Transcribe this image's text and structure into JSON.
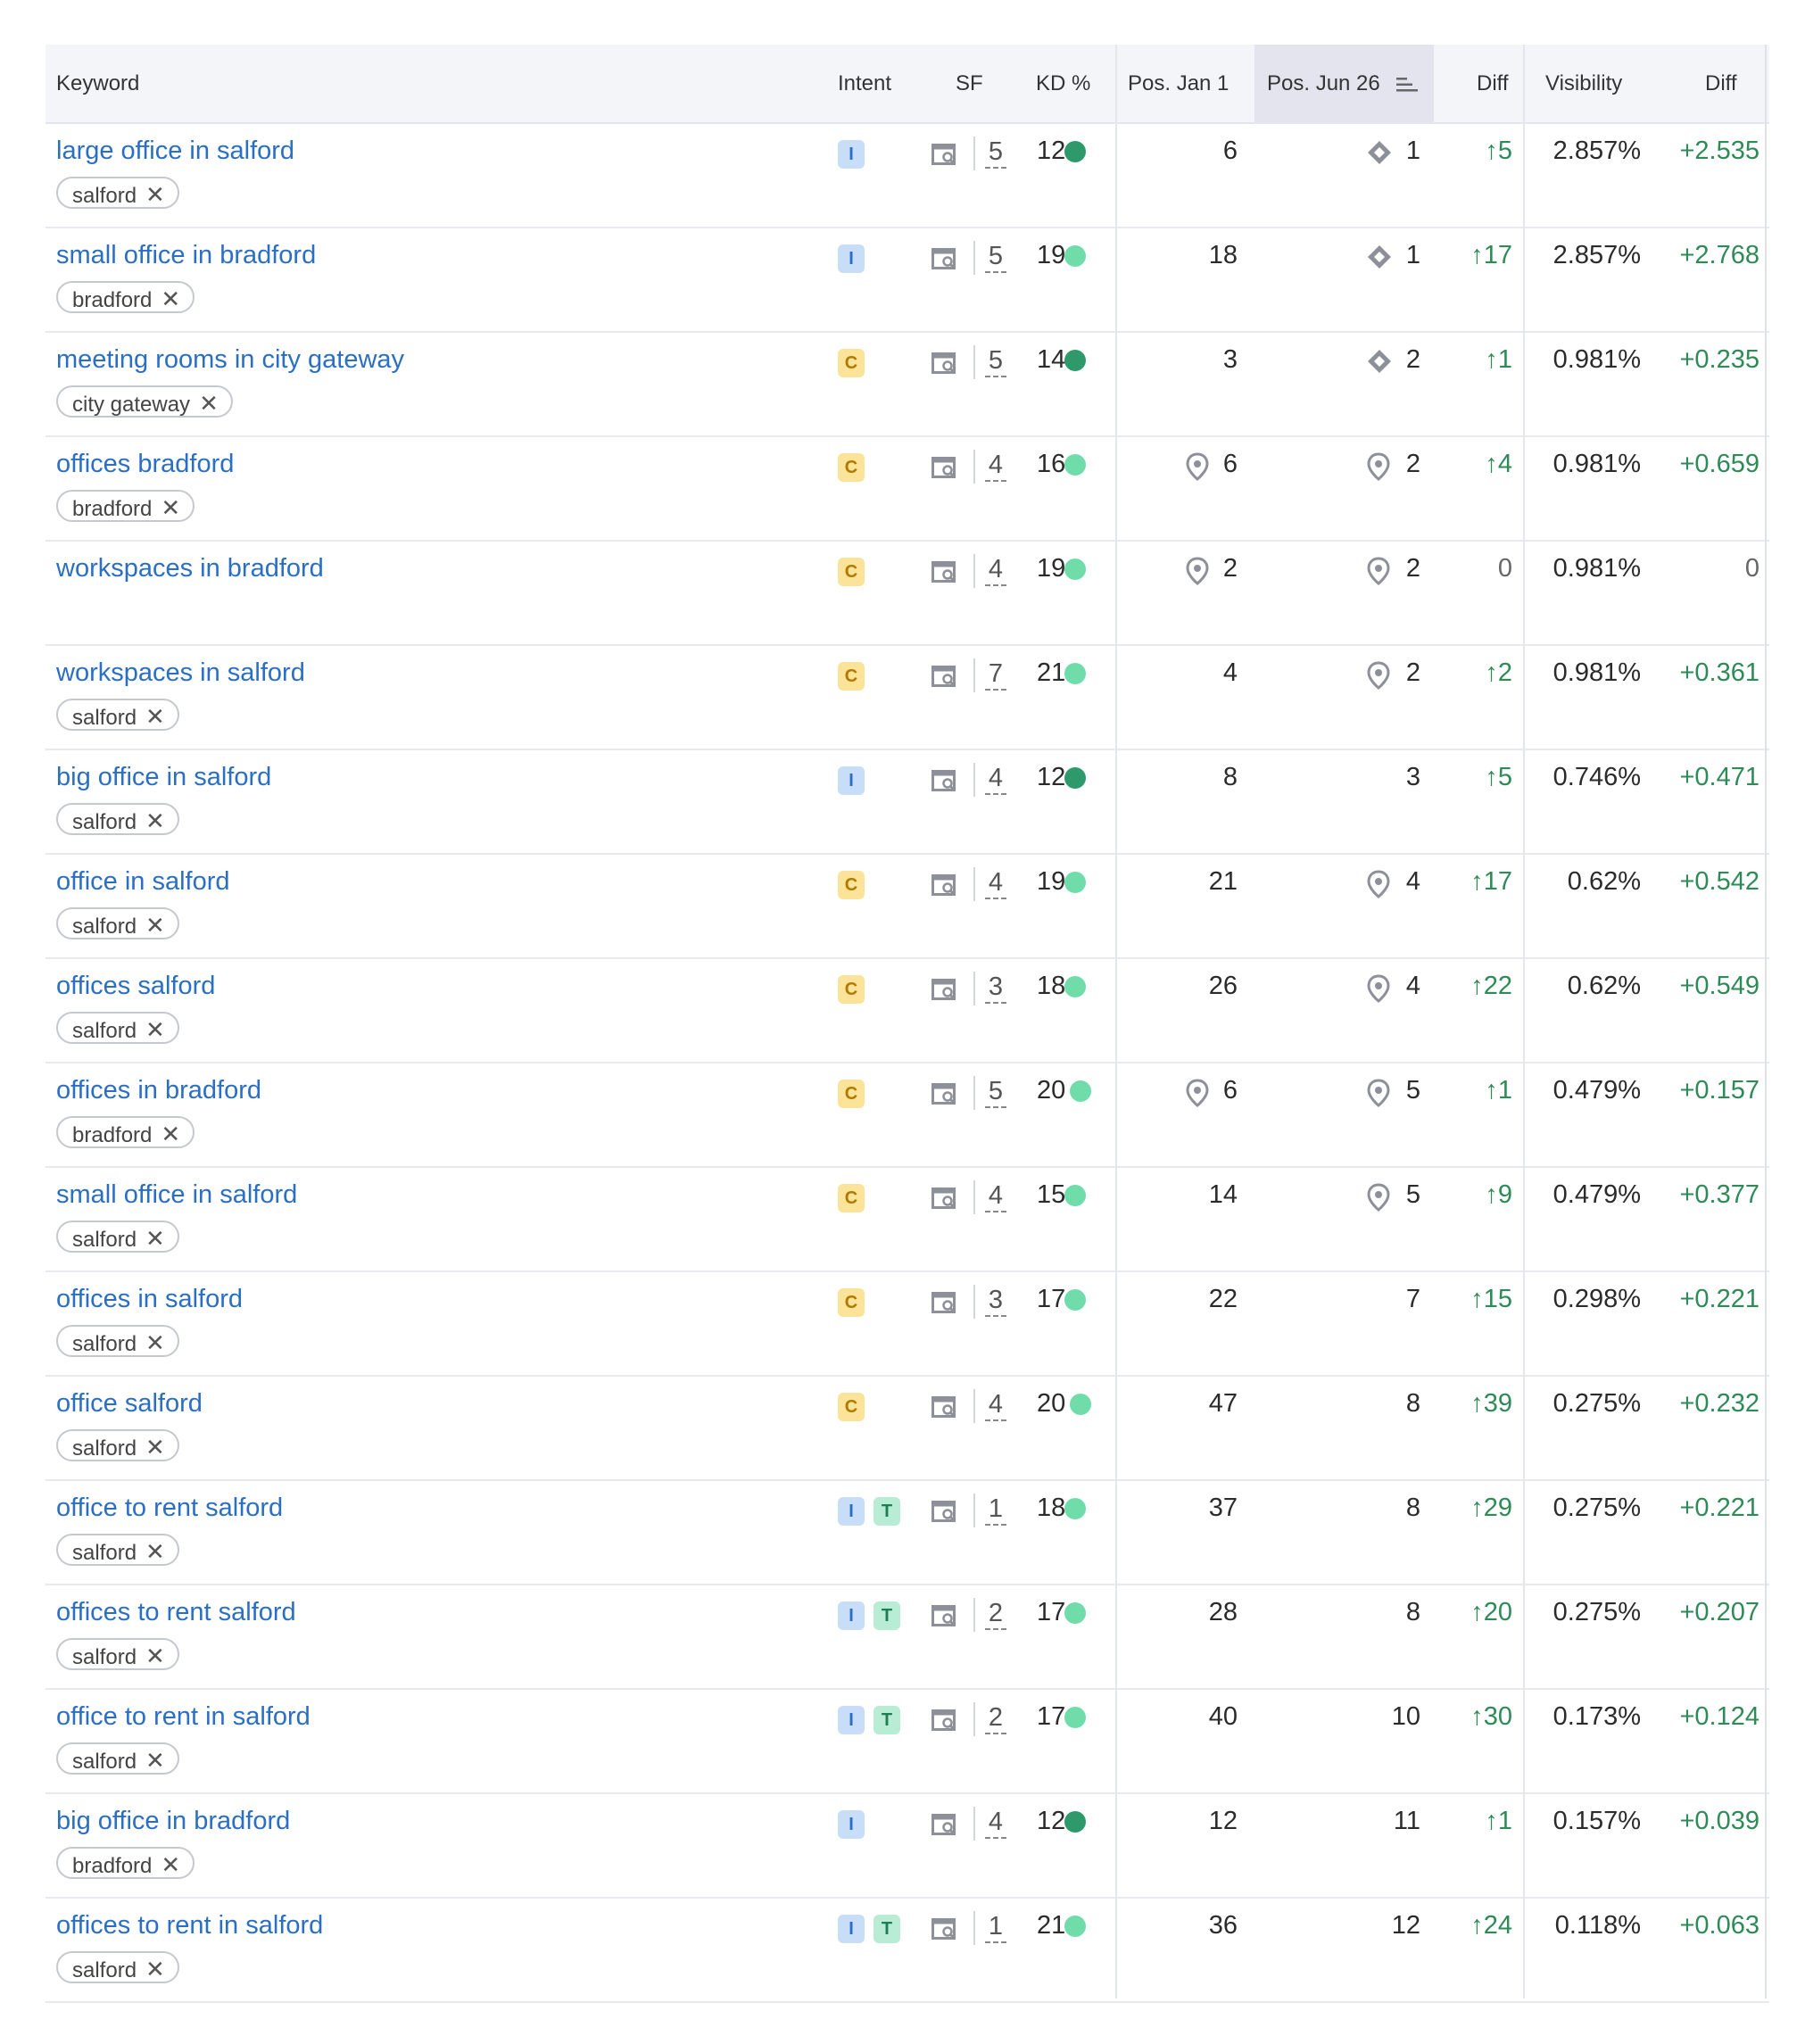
{
  "headers": {
    "keyword": "Keyword",
    "intent": "Intent",
    "sf": "SF",
    "kd": "KD %",
    "pos_jan": "Pos. Jan 1",
    "pos_jun": "Pos. Jun 26",
    "diff": "Diff",
    "visibility": "Visibility",
    "vis_diff": "Diff"
  },
  "colors": {
    "kd_dark": "#2e9a6b",
    "kd_light": "#6fdcaa",
    "link": "#2a6fc4",
    "up": "#2e8b57"
  },
  "rows": [
    {
      "keyword": "large office in salford",
      "tag": "salford",
      "intent": [
        "I"
      ],
      "sf": "5",
      "kd": "12",
      "kd_color": "dark",
      "pos_jan": "6",
      "pos_jan_icon": "",
      "pos_jun": "1",
      "pos_jun_icon": "featured-snippet",
      "diff": "↑5",
      "visibility": "2.857%",
      "vis_diff": "+2.535"
    },
    {
      "keyword": "small office in bradford",
      "tag": "bradford",
      "intent": [
        "I"
      ],
      "sf": "5",
      "kd": "19",
      "kd_color": "light",
      "pos_jan": "18",
      "pos_jan_icon": "",
      "pos_jun": "1",
      "pos_jun_icon": "featured-snippet",
      "diff": "↑17",
      "visibility": "2.857%",
      "vis_diff": "+2.768"
    },
    {
      "keyword": "meeting rooms in city gateway",
      "tag": "city gateway",
      "intent": [
        "C"
      ],
      "sf": "5",
      "kd": "14",
      "kd_color": "dark",
      "pos_jan": "3",
      "pos_jan_icon": "",
      "pos_jun": "2",
      "pos_jun_icon": "featured-snippet",
      "diff": "↑1",
      "visibility": "0.981%",
      "vis_diff": "+0.235"
    },
    {
      "keyword": "offices bradford",
      "tag": "bradford",
      "intent": [
        "C"
      ],
      "sf": "4",
      "kd": "16",
      "kd_color": "light",
      "pos_jan": "6",
      "pos_jan_icon": "local-pack",
      "pos_jun": "2",
      "pos_jun_icon": "local-pack",
      "diff": "↑4",
      "visibility": "0.981%",
      "vis_diff": "+0.659"
    },
    {
      "keyword": "workspaces in bradford",
      "tag": "",
      "intent": [
        "C"
      ],
      "sf": "4",
      "kd": "19",
      "kd_color": "light",
      "pos_jan": "2",
      "pos_jan_icon": "local-pack",
      "pos_jun": "2",
      "pos_jun_icon": "local-pack",
      "diff": "0",
      "visibility": "0.981%",
      "vis_diff": "0"
    },
    {
      "keyword": "workspaces in salford",
      "tag": "salford",
      "intent": [
        "C"
      ],
      "sf": "7",
      "kd": "21",
      "kd_color": "light",
      "pos_jan": "4",
      "pos_jan_icon": "",
      "pos_jun": "2",
      "pos_jun_icon": "local-pack",
      "diff": "↑2",
      "visibility": "0.981%",
      "vis_diff": "+0.361"
    },
    {
      "keyword": "big office in salford",
      "tag": "salford",
      "intent": [
        "I"
      ],
      "sf": "4",
      "kd": "12",
      "kd_color": "dark",
      "pos_jan": "8",
      "pos_jan_icon": "",
      "pos_jun": "3",
      "pos_jun_icon": "",
      "diff": "↑5",
      "visibility": "0.746%",
      "vis_diff": "+0.471"
    },
    {
      "keyword": "office in salford",
      "tag": "salford",
      "intent": [
        "C"
      ],
      "sf": "4",
      "kd": "19",
      "kd_color": "light",
      "pos_jan": "21",
      "pos_jan_icon": "",
      "pos_jun": "4",
      "pos_jun_icon": "local-pack",
      "diff": "↑17",
      "visibility": "0.62%",
      "vis_diff": "+0.542"
    },
    {
      "keyword": "offices salford",
      "tag": "salford",
      "intent": [
        "C"
      ],
      "sf": "3",
      "kd": "18",
      "kd_color": "light",
      "pos_jan": "26",
      "pos_jan_icon": "",
      "pos_jun": "4",
      "pos_jun_icon": "local-pack",
      "diff": "↑22",
      "visibility": "0.62%",
      "vis_diff": "+0.549"
    },
    {
      "keyword": "offices in bradford",
      "tag": "bradford",
      "intent": [
        "C"
      ],
      "sf": "5",
      "kd": "20",
      "kd_color": "light",
      "pos_jan": "6",
      "pos_jan_icon": "local-pack",
      "pos_jun": "5",
      "pos_jun_icon": "local-pack",
      "diff": "↑1",
      "visibility": "0.479%",
      "vis_diff": "+0.157"
    },
    {
      "keyword": "small office in salford",
      "tag": "salford",
      "intent": [
        "C"
      ],
      "sf": "4",
      "kd": "15",
      "kd_color": "light",
      "pos_jan": "14",
      "pos_jan_icon": "",
      "pos_jun": "5",
      "pos_jun_icon": "local-pack",
      "diff": "↑9",
      "visibility": "0.479%",
      "vis_diff": "+0.377"
    },
    {
      "keyword": "offices in salford",
      "tag": "salford",
      "intent": [
        "C"
      ],
      "sf": "3",
      "kd": "17",
      "kd_color": "light",
      "pos_jan": "22",
      "pos_jan_icon": "",
      "pos_jun": "7",
      "pos_jun_icon": "",
      "diff": "↑15",
      "visibility": "0.298%",
      "vis_diff": "+0.221"
    },
    {
      "keyword": "office salford",
      "tag": "salford",
      "intent": [
        "C"
      ],
      "sf": "4",
      "kd": "20",
      "kd_color": "light",
      "pos_jan": "47",
      "pos_jan_icon": "",
      "pos_jun": "8",
      "pos_jun_icon": "",
      "diff": "↑39",
      "visibility": "0.275%",
      "vis_diff": "+0.232"
    },
    {
      "keyword": "office to rent salford",
      "tag": "salford",
      "intent": [
        "I",
        "T"
      ],
      "sf": "1",
      "kd": "18",
      "kd_color": "light",
      "pos_jan": "37",
      "pos_jan_icon": "",
      "pos_jun": "8",
      "pos_jun_icon": "",
      "diff": "↑29",
      "visibility": "0.275%",
      "vis_diff": "+0.221"
    },
    {
      "keyword": "offices to rent salford",
      "tag": "salford",
      "intent": [
        "I",
        "T"
      ],
      "sf": "2",
      "kd": "17",
      "kd_color": "light",
      "pos_jan": "28",
      "pos_jan_icon": "",
      "pos_jun": "8",
      "pos_jun_icon": "",
      "diff": "↑20",
      "visibility": "0.275%",
      "vis_diff": "+0.207"
    },
    {
      "keyword": "office to rent in salford",
      "tag": "salford",
      "intent": [
        "I",
        "T"
      ],
      "sf": "2",
      "kd": "17",
      "kd_color": "light",
      "pos_jan": "40",
      "pos_jan_icon": "",
      "pos_jun": "10",
      "pos_jun_icon": "",
      "diff": "↑30",
      "visibility": "0.173%",
      "vis_diff": "+0.124"
    },
    {
      "keyword": "big office in bradford",
      "tag": "bradford",
      "intent": [
        "I"
      ],
      "sf": "4",
      "kd": "12",
      "kd_color": "dark",
      "pos_jan": "12",
      "pos_jan_icon": "",
      "pos_jun": "11",
      "pos_jun_icon": "",
      "diff": "↑1",
      "visibility": "0.157%",
      "vis_diff": "+0.039"
    },
    {
      "keyword": "offices to rent in salford",
      "tag": "salford",
      "intent": [
        "I",
        "T"
      ],
      "sf": "1",
      "kd": "21",
      "kd_color": "light",
      "pos_jan": "36",
      "pos_jan_icon": "",
      "pos_jun": "12",
      "pos_jun_icon": "",
      "diff": "↑24",
      "visibility": "0.118%",
      "vis_diff": "+0.063"
    }
  ]
}
